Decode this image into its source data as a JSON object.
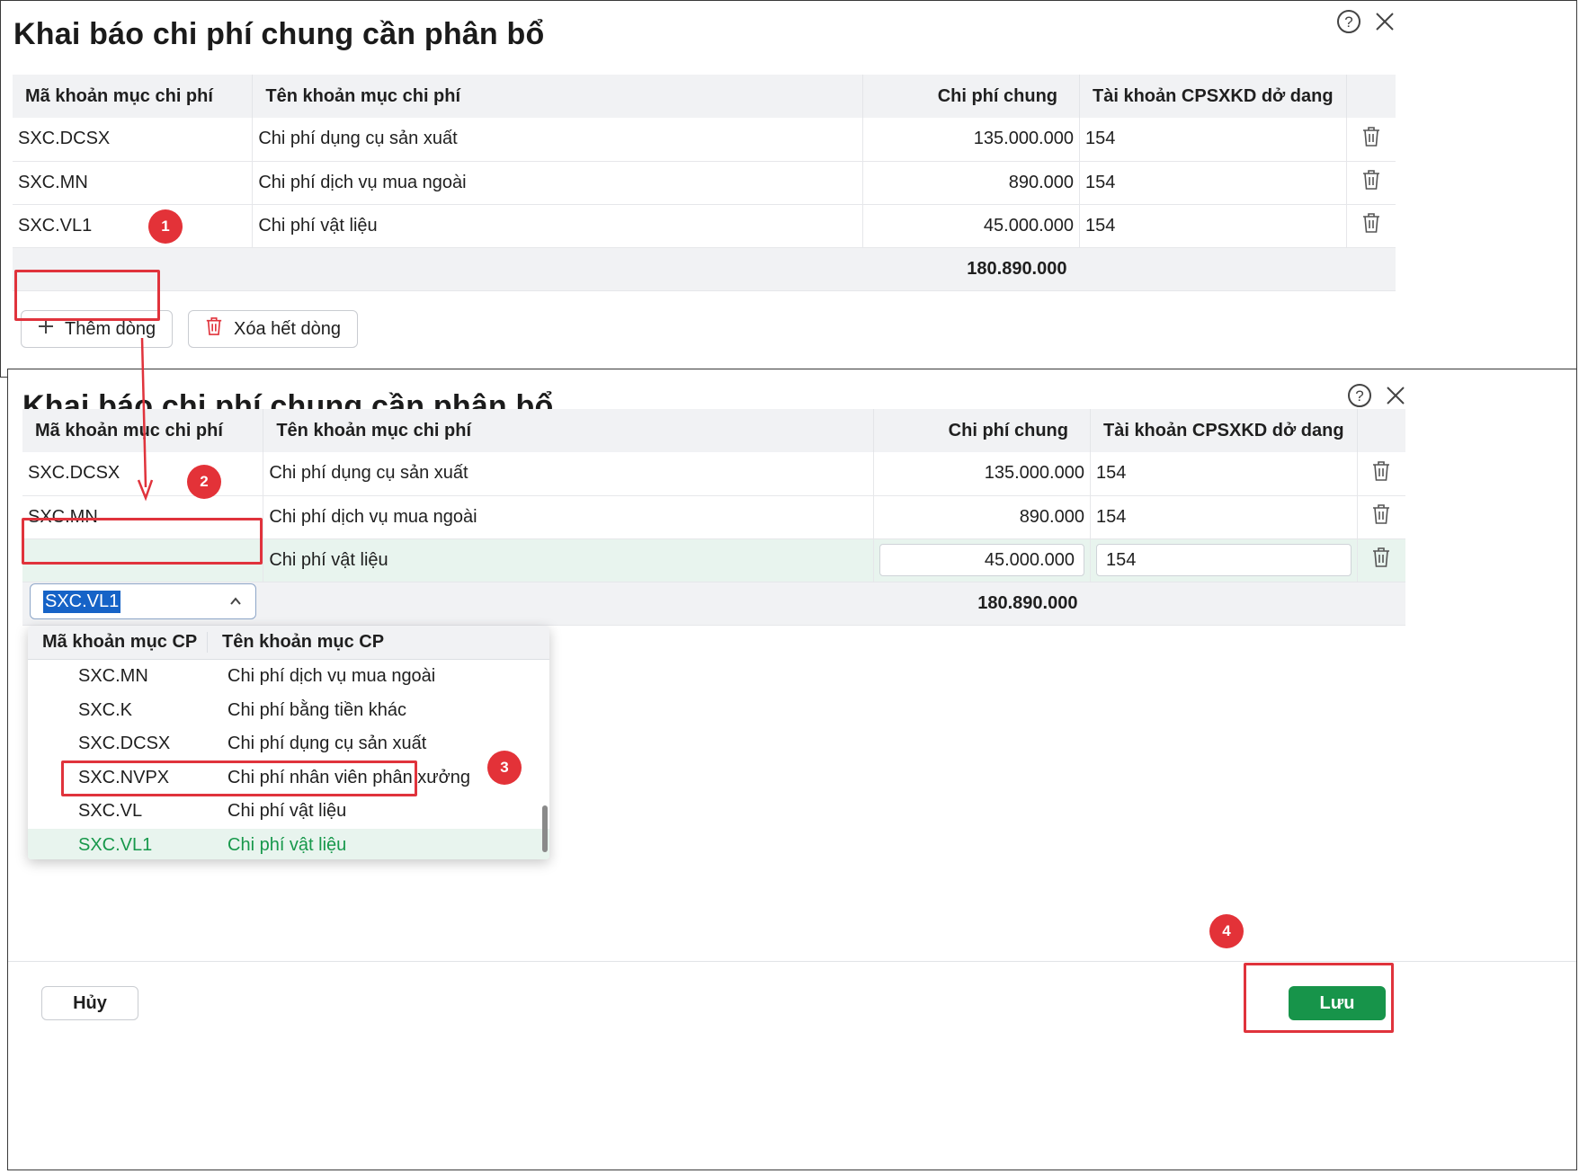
{
  "dialog1": {
    "title": "Khai báo chi phí chung cần phân bổ",
    "columns": {
      "code": "Mã khoản mục chi phí",
      "name": "Tên khoản mục chi phí",
      "amount": "Chi phí chung",
      "account": "Tài khoản CPSXKD dở dang"
    },
    "rows": [
      {
        "code": "SXC.DCSX",
        "name": "Chi phí dụng cụ sản xuất",
        "amount": "135.000.000",
        "account": "154"
      },
      {
        "code": "SXC.MN",
        "name": "Chi phí dịch vụ mua ngoài",
        "amount": "890.000",
        "account": "154"
      },
      {
        "code": "SXC.VL1",
        "name": "Chi phí vật liệu",
        "amount": "45.000.000",
        "account": "154"
      }
    ],
    "total": "180.890.000",
    "add_row_label": "Thêm dòng",
    "clear_rows_label": "Xóa hết dòng"
  },
  "dialog2": {
    "title": "Khai báo chi phí chung cần phân bổ",
    "columns": {
      "code": "Mã khoản mục chi phí",
      "name": "Tên khoản mục chi phí",
      "amount": "Chi phí chung",
      "account": "Tài khoản CPSXKD dở dang"
    },
    "rows": [
      {
        "code": "SXC.DCSX",
        "name": "Chi phí dụng cụ sản xuất",
        "amount": "135.000.000",
        "account": "154"
      },
      {
        "code": "SXC.MN",
        "name": "Chi phí dịch vụ mua ngoài",
        "amount": "890.000",
        "account": "154"
      }
    ],
    "active_row": {
      "code": "SXC.VL1",
      "name": "Chi phí vật liệu",
      "amount": "45.000.000",
      "account": "154"
    },
    "total": "180.890.000",
    "dropdown": {
      "col_code": "Mã khoản mục CP",
      "col_name": "Tên khoản mục CP",
      "items": [
        {
          "code": "SXC.MN",
          "name": "Chi phí dịch vụ mua ngoài"
        },
        {
          "code": "SXC.K",
          "name": "Chi phí bằng tiền khác"
        },
        {
          "code": "SXC.DCSX",
          "name": "Chi phí dụng cụ sản xuất"
        },
        {
          "code": "SXC.NVPX",
          "name": "Chi phí nhân viên phân xưởng"
        },
        {
          "code": "SXC.VL",
          "name": "Chi phí vật liệu"
        },
        {
          "code": "SXC.VL1",
          "name": "Chi phí vật liệu"
        }
      ]
    },
    "cancel_label": "Hủy",
    "save_label": "Lưu"
  },
  "annotations": {
    "step1": "1",
    "step2": "2",
    "step3": "3",
    "step4": "4"
  },
  "colors": {
    "accent_green": "#17944a",
    "selected_text": "#17984b",
    "highlight_red": "#e0333c"
  }
}
